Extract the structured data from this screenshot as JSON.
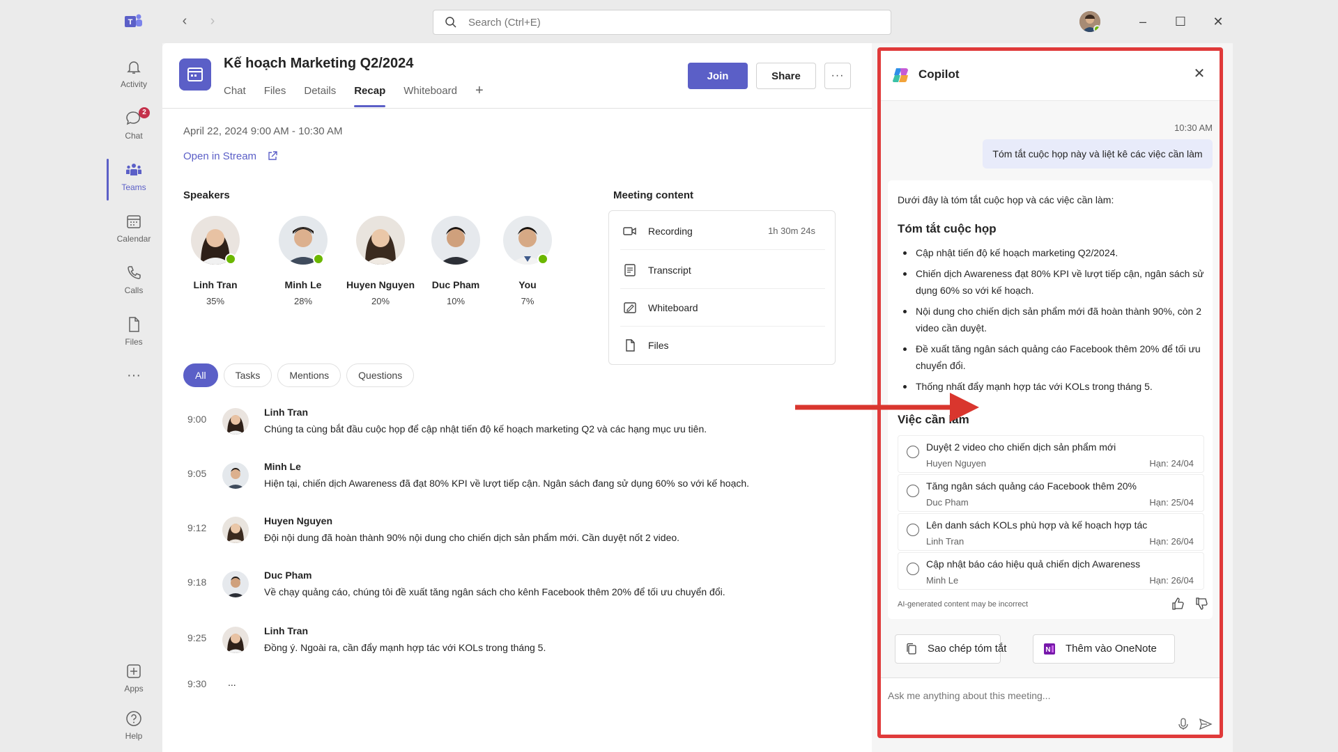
{
  "window": {
    "search_placeholder": "Search (Ctrl+E)"
  },
  "rail": {
    "items": [
      {
        "label": "Activity",
        "icon": "bell-icon"
      },
      {
        "label": "Chat",
        "icon": "chat-icon",
        "badge": "2"
      },
      {
        "label": "Teams",
        "icon": "teams-icon"
      },
      {
        "label": "Calendar",
        "icon": "calendar-icon"
      },
      {
        "label": "Calls",
        "icon": "phone-icon"
      },
      {
        "label": "Files",
        "icon": "file-icon"
      },
      {
        "label": "Apps",
        "icon": "apps-icon"
      },
      {
        "label": "Help",
        "icon": "help-icon"
      }
    ],
    "more": "···"
  },
  "meeting": {
    "title": "Kế hoạch Marketing Q2/2024",
    "tabs": [
      "Chat",
      "Files",
      "Details",
      "Recap",
      "Whiteboard"
    ],
    "active_tab": "Recap",
    "join_label": "Join",
    "share_label": "Share",
    "more_label": "···",
    "date": "April 22, 2024   9:00 AM - 10:30 AM",
    "open_stream": "Open in Stream"
  },
  "speakers": {
    "title": "Speakers",
    "list": [
      {
        "name": "Linh Tran",
        "percent": "35%"
      },
      {
        "name": "Minh Le",
        "percent": "28%"
      },
      {
        "name": "Huyen Nguyen",
        "percent": "20%"
      },
      {
        "name": "Duc Pham",
        "percent": "10%"
      },
      {
        "name": "You",
        "percent": "7%"
      }
    ]
  },
  "meeting_content": {
    "title": "Meeting content",
    "items": [
      {
        "label": "Recording",
        "meta": "1h 30m 24s",
        "icon": "video-icon"
      },
      {
        "label": "Transcript",
        "meta": "",
        "icon": "transcript-icon"
      },
      {
        "label": "Whiteboard",
        "meta": "",
        "icon": "whiteboard-icon"
      },
      {
        "label": "Files",
        "meta": "",
        "icon": "file-icon"
      }
    ]
  },
  "filters": [
    "All",
    "Tasks",
    "Mentions",
    "Questions"
  ],
  "transcript": [
    {
      "time": "9:00",
      "name": "Linh Tran",
      "text": "Chúng ta cùng bắt đầu cuộc họp để cập nhật tiến độ kế hoạch marketing Q2 và các hạng mục ưu tiên."
    },
    {
      "time": "9:05",
      "name": "Minh Le",
      "text": "Hiện tại, chiến dịch Awareness đã đạt 80% KPI về lượt tiếp cận. Ngân sách đang sử dụng 60% so với kế hoạch."
    },
    {
      "time": "9:12",
      "name": "Huyen Nguyen",
      "text": "Đội nội dung đã hoàn thành 90% nội dung cho chiến dịch sản phẩm mới. Cần duyệt nốt 2 video."
    },
    {
      "time": "9:18",
      "name": "Duc Pham",
      "text": "Về chạy quảng cáo, chúng tôi đề xuất tăng ngân sách cho kênh Facebook thêm 20% để tối ưu chuyển đổi."
    },
    {
      "time": "9:25",
      "name": "Linh Tran",
      "text": "Đồng ý. Ngoài ra, cần đẩy mạnh hợp tác với KOLs trong tháng 5."
    },
    {
      "time": "9:30",
      "name": "",
      "text": "..."
    }
  ],
  "copilot": {
    "title": "Copilot",
    "close": "✕",
    "time": "10:30 AM",
    "user_message": "Tóm tắt cuộc họp này và liệt kê các việc cần làm",
    "intro": "Dưới đây là tóm tắt cuộc họp và các việc cần làm:",
    "summary_title": "Tóm tắt cuộc họp",
    "summary": [
      "Cập nhật tiến độ kế hoạch marketing Q2/2024.",
      "Chiến dịch Awareness đạt 80% KPI về lượt tiếp cận, ngân sách sử dụng 60% so với kế hoạch.",
      "Nội dung cho chiến dịch sản phẩm mới đã hoàn thành 90%, còn 2 video cần duyệt.",
      "Đề xuất tăng ngân sách quảng cáo Facebook thêm 20% để tối ưu chuyển đổi.",
      "Thống nhất đẩy mạnh hợp tác với KOLs trong tháng 5."
    ],
    "tasks_title": "Việc cần làm",
    "tasks": [
      {
        "title": "Duyệt 2 video cho chiến dịch sản phẩm mới",
        "owner": "Huyen Nguyen",
        "due": "Hạn: 24/04"
      },
      {
        "title": "Tăng ngân sách quảng cáo Facebook thêm 20%",
        "owner": "Duc Pham",
        "due": "Hạn: 25/04"
      },
      {
        "title": "Lên danh sách KOLs phù hợp và kế hoạch hợp tác",
        "owner": "Linh Tran",
        "due": "Hạn: 26/04"
      },
      {
        "title": "Cập nhật báo cáo hiệu quả chiến dịch Awareness",
        "owner": "Minh Le",
        "due": "Hạn: 26/04"
      }
    ],
    "disclaimer": "AI-generated content may be incorrect",
    "copy_label": "Sao chép tóm tắt",
    "onenote_label": "Thêm vào OneNote",
    "input_placeholder": "Ask me anything about this meeting..."
  },
  "colors": {
    "accent": "#5b5fc7",
    "highlight_border": "#e03a3a",
    "presence": "#6bb700",
    "badge": "#c4314b"
  }
}
